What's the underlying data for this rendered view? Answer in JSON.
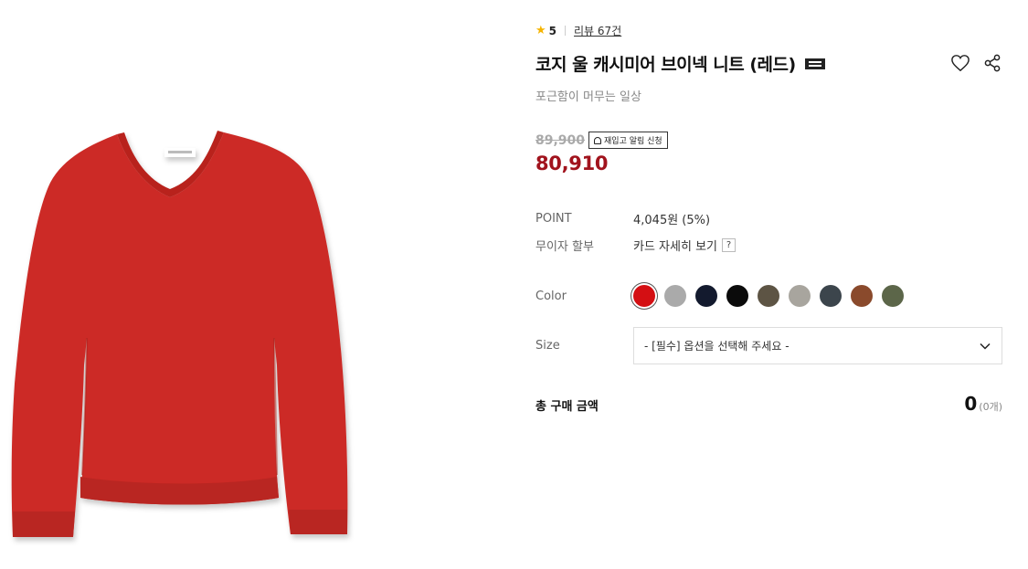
{
  "product": {
    "rating": "5",
    "review_link": "리뷰 67건",
    "title": "코지 울 캐시미어 브이넥 니트 (레드)",
    "subtitle": "포근함이 머무는 일상",
    "original_price": "89,900",
    "restock_label": "재입고 알림 신청",
    "sale_price": "80,910"
  },
  "details": {
    "point_label": "POINT",
    "point_value": "4,045원 (5%)",
    "installment_label": "무이자 할부",
    "installment_value": "카드 자세히 보기",
    "help_glyph": "?"
  },
  "options": {
    "color_label": "Color",
    "colors": [
      "#d40f13",
      "#aaaaaa",
      "#131a2e",
      "#0b0b0b",
      "#5d5444",
      "#a8a59e",
      "#3c454c",
      "#8a4a2c",
      "#5c6649"
    ],
    "selected_color_index": 0,
    "size_label": "Size",
    "size_placeholder": "- [필수] 옵션을 선택해 주세요 -"
  },
  "total": {
    "label": "총 구매 금액",
    "amount": "0",
    "count": "(0개)"
  },
  "theme": {
    "sale_price_color": "#a1131d",
    "star_color": "#f5b400",
    "sweater_color": "#cc2b25"
  }
}
